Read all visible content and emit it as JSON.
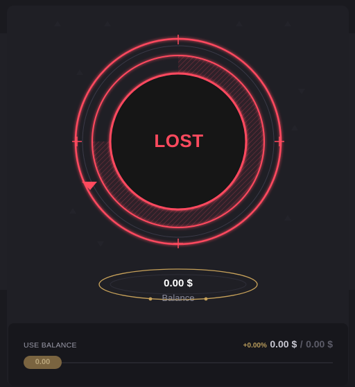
{
  "game": {
    "status": "LOST",
    "colors": {
      "accent": "#ff4a5e",
      "gold": "#c8a25a",
      "card": "#1f1f25"
    }
  },
  "balance": {
    "amount": "0.00 $",
    "label": "Balance"
  },
  "controls": {
    "use_balance_label": "USE BALANCE",
    "change_percent": "+0.00%",
    "current_amount": "0.00 $",
    "separator": "/",
    "max_amount": "0.00 $",
    "slider_value": "0.00",
    "slider_fraction": 0
  }
}
